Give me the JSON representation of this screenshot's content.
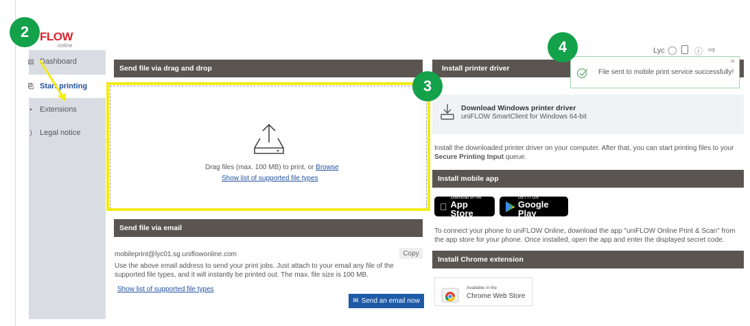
{
  "app": {
    "logo_text": "FLOW",
    "logo_sub": "online",
    "user_label": "Lyc"
  },
  "sidebar": {
    "items": [
      {
        "label": "Dashboard"
      },
      {
        "label": "Start printing"
      },
      {
        "label": "Extensions"
      },
      {
        "label": "Legal notice"
      }
    ]
  },
  "dragdrop": {
    "header": "Send file via drag and drop",
    "instruction": "Drag files (max. 100 MB) to print, or",
    "browse": "Browse",
    "supported_link": "Show list of supported file types"
  },
  "email": {
    "header": "Send file via email",
    "address": "mobileprint@lyc01.sg.uniflowonline.com",
    "copy_label": "Copy",
    "description": "Use the above email address to send your print jobs. Just attach to your email any file of the supported file types, and it will instantly be printed out. The max. file size is 100 MB.",
    "supported_link": "Show list of supported file types",
    "send_button": "Send an email now"
  },
  "printer_driver": {
    "header": "Install printer driver",
    "download_title": "Download Windows printer driver",
    "download_sub": "uniFLOW SmartClient for Windows 64-bit",
    "instruction_pre": "Install the downloaded printer driver on your computer. After that, you can start printing files to your",
    "queue_name": "Secure Printing Input",
    "instruction_post": "queue."
  },
  "mobile_app": {
    "header": "Install mobile app",
    "appstore_small": "Download on the",
    "appstore_big": "App Store",
    "googleplay_small": "GET IT ON",
    "googleplay_big": "Google Play",
    "description": "To connect your phone to uniFLOW Online, download the app \"uniFLOW Online Print & Scan\" from the app store for your phone. Once installed, open the app and enter the displayed secret code."
  },
  "chrome_ext": {
    "header": "Install Chrome extension",
    "small": "Available in the",
    "big": "Chrome Web Store"
  },
  "toast": {
    "message": "File sent to mobile print service successfully!"
  },
  "badges": {
    "b2": "2",
    "b3": "3",
    "b4": "4"
  },
  "colors": {
    "badge_green": "#13a14a",
    "highlight_yellow": "#f2ec12",
    "header_bar": "#5a5550",
    "link_blue": "#1f4e9c"
  }
}
